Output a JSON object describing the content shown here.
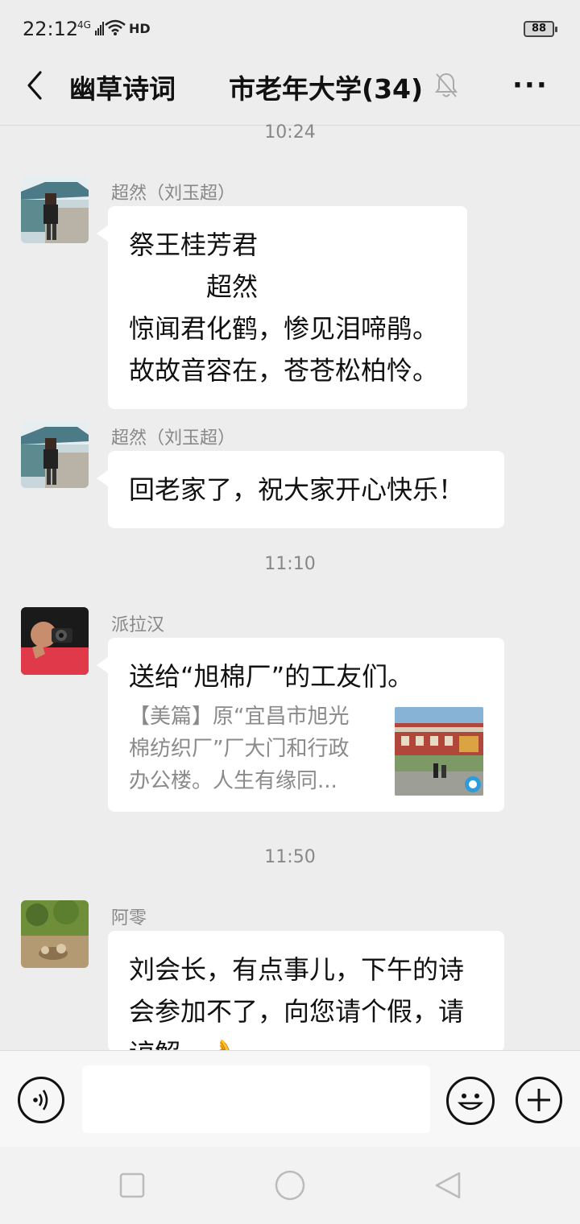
{
  "status_bar": {
    "time": "22:12",
    "network": "4G",
    "hd": "HD",
    "battery": "88"
  },
  "header": {
    "title": "幽草诗词　　市老年大学(34)"
  },
  "messages": [
    {
      "timestamp": "10:24"
    },
    {
      "sender": "超然（刘玉超）",
      "lines": [
        "祭王桂芳君",
        "　　　超然",
        "惊闻君化鹤，惨见泪啼鹃。",
        "故故音容在，苍苍松柏怜。"
      ]
    },
    {
      "sender": "超然（刘玉超）",
      "lines": [
        "回老家了，祝大家开心快乐！"
      ]
    },
    {
      "timestamp": "11:10"
    },
    {
      "sender": "派拉汉",
      "share_title": "送给“旭棉厂”的工友们。",
      "share_desc_lines": [
        "【美篇】原“宜昌市旭光",
        "棉纺织厂”厂大门和行政",
        "办公楼。人生有缘同..."
      ]
    },
    {
      "timestamp": "11:50"
    },
    {
      "sender": "阿零",
      "lines": [
        "刘会长，有点事儿，下午的诗",
        "会参加不了，向您请个假，请",
        "谅解。👌"
      ]
    }
  ],
  "icons": {
    "back": "chevron-left-icon",
    "mute": "bell-off-icon",
    "more": "more-dots-icon",
    "voice": "voice-icon",
    "emoji": "emoji-icon",
    "plus": "plus-icon"
  },
  "colors": {
    "background": "#ededed",
    "bubble": "#ffffff",
    "meta_text": "#888888"
  }
}
